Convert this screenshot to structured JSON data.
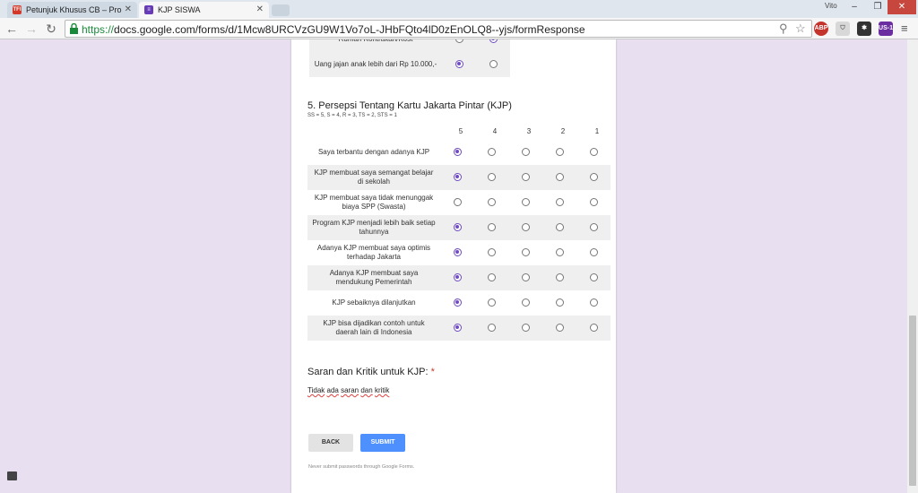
{
  "browser": {
    "tabs": [
      {
        "title": "Petunjuk Khusus CB – Pro",
        "favicon": "TFI",
        "active": false
      },
      {
        "title": "KJP SISWA",
        "active": true
      }
    ],
    "user": "Vito",
    "url_scheme": "https://",
    "url_rest": "docs.google.com/forms/d/1Mcw8URCVzGU9W1Vo7oL-JHbFQto4lD0zEnOLQ8--yjs/formResponse",
    "ext_abp": "ABP",
    "ext_us": "US-1"
  },
  "form": {
    "prev_rows": [
      {
        "statement": "Rumah Kontrakan/Kost",
        "selected": 1
      },
      {
        "statement": "Uang jajan anak lebih dari Rp 10.000,-",
        "selected": 0
      }
    ],
    "section_title": "5. Persepsi Tentang Kartu Jakarta Pintar (KJP)",
    "scale_note": "SS = 5, S = 4, R = 3, TS = 2, STS = 1",
    "columns": [
      "5",
      "4",
      "3",
      "2",
      "1"
    ],
    "rows": [
      {
        "statement": "Saya terbantu dengan adanya KJP",
        "selected": 0
      },
      {
        "statement": "KJP membuat saya semangat belajar di sekolah",
        "selected": 0
      },
      {
        "statement": "KJP membuat saya tidak menunggak biaya SPP (Swasta)",
        "selected": -1
      },
      {
        "statement": "Program KJP menjadi lebih baik setiap tahunnya",
        "selected": 0
      },
      {
        "statement": "Adanya KJP membuat saya optimis terhadap Jakarta",
        "selected": 0
      },
      {
        "statement": "Adanya KJP membuat saya mendukung Pemerintah",
        "selected": 0
      },
      {
        "statement": "KJP sebaiknya dilanjutkan",
        "selected": 0
      },
      {
        "statement": "KJP bisa dijadikan contoh untuk daerah lain di Indonesia",
        "selected": 0
      }
    ],
    "question_title": "Saran dan Kritik untuk KJP:",
    "required_mark": "*",
    "answer_words": [
      "Tidak",
      "ada",
      "saran",
      "dan",
      "kritik"
    ],
    "back_label": "BACK",
    "submit_label": "SUBMIT",
    "footer_note": "Never submit passwords through Google Forms."
  }
}
